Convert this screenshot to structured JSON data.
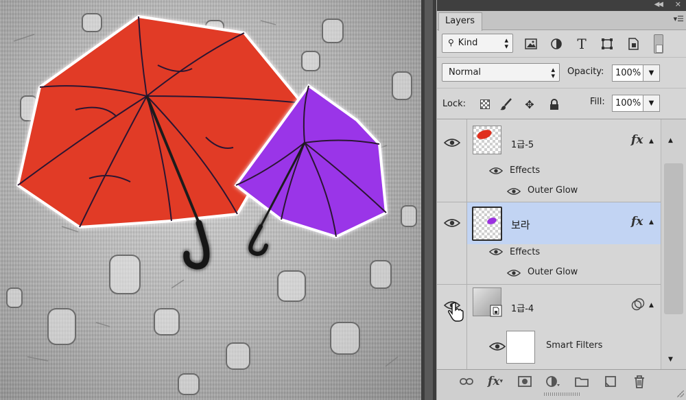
{
  "panel": {
    "dock_collapse_icon": "double-chevron-left-icon",
    "dock_close_icon": "close-icon",
    "tab_label": "Layers",
    "menu_icon": "panel-menu-icon"
  },
  "filter": {
    "kind_value": "Kind",
    "icons": [
      "pixel-layer-filter-icon",
      "adjustment-layer-filter-icon",
      "type-layer-filter-icon",
      "shape-layer-filter-icon",
      "smart-object-filter-icon"
    ]
  },
  "blend": {
    "mode_value": "Normal",
    "opacity_label": "Opacity:",
    "opacity_value": "100%"
  },
  "lock": {
    "label": "Lock:",
    "fill_label": "Fill:",
    "fill_value": "100%",
    "icons": [
      "lock-transparent-pixels-icon",
      "lock-image-pixels-icon",
      "lock-position-icon",
      "lock-all-icon"
    ]
  },
  "layers": [
    {
      "name": "1급-5",
      "selected": false,
      "has_fx": true,
      "effects_label": "Effects",
      "effect": "Outer Glow",
      "thumb_color": "#e0301e"
    },
    {
      "name": "보라",
      "selected": true,
      "has_fx": true,
      "effects_label": "Effects",
      "effect": "Outer Glow",
      "thumb_color": "#9b30e0"
    },
    {
      "name": "1급-4",
      "selected": false,
      "has_fx": false,
      "smart_filters_label": "Smart Filters"
    }
  ],
  "fx_symbol": "fx",
  "colors": {
    "selected_row": "#c2d4f3",
    "panel_bg": "#d6d6d6",
    "red_umbrella": "#e13a27",
    "purple_umbrella": "#9a35e8"
  },
  "bottom_bar": {
    "icons": [
      "link-layers-icon",
      "add-layer-style-icon",
      "add-mask-icon",
      "new-adjustment-layer-icon",
      "new-group-icon",
      "new-layer-icon",
      "delete-layer-icon"
    ]
  }
}
